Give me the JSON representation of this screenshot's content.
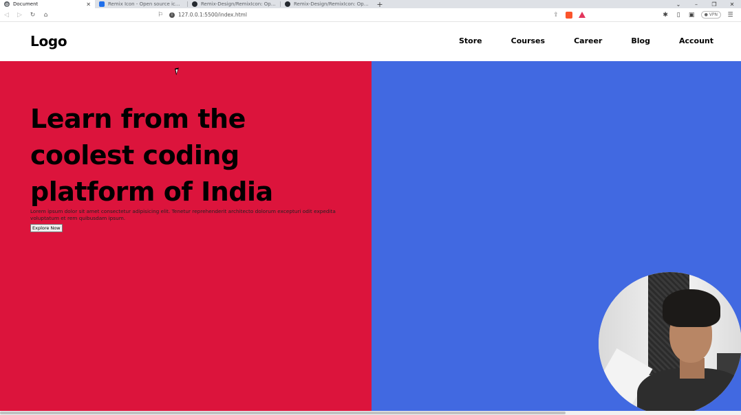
{
  "browser": {
    "tabs": [
      {
        "title": "Document",
        "active": true,
        "favicon": "globe-icon"
      },
      {
        "title": "Remix Icon - Open source icon library",
        "active": false,
        "favicon": "remix-icon"
      },
      {
        "title": "Remix-Design/RemixIcon: Open source",
        "active": false,
        "favicon": "github-icon"
      },
      {
        "title": "Remix-Design/RemixIcon: Open source",
        "active": false,
        "favicon": "github-icon"
      }
    ],
    "new_tab": "+",
    "tab_close": "✕",
    "url": "127.0.0.1:5500/index.html",
    "vpn_label": "VPN",
    "window_controls": {
      "list": "⌄",
      "minimize": "–",
      "restore": "❐",
      "close": "✕"
    }
  },
  "site": {
    "logo": "Logo",
    "nav": [
      "Store",
      "Courses",
      "Career",
      "Blog",
      "Account"
    ],
    "hero": {
      "title": "Learn from the coolest coding platform of India",
      "text": "Lorem ipsum dolor sit amet consectetur adipisicing elit. Tenetur reprehenderit architecto dolorum excepturi odit expedita voluptatum et rem quibusdam ipsum.",
      "button": "Explore Now"
    }
  },
  "colors": {
    "hero_left": "#dc143c",
    "hero_right": "#4169e1"
  }
}
